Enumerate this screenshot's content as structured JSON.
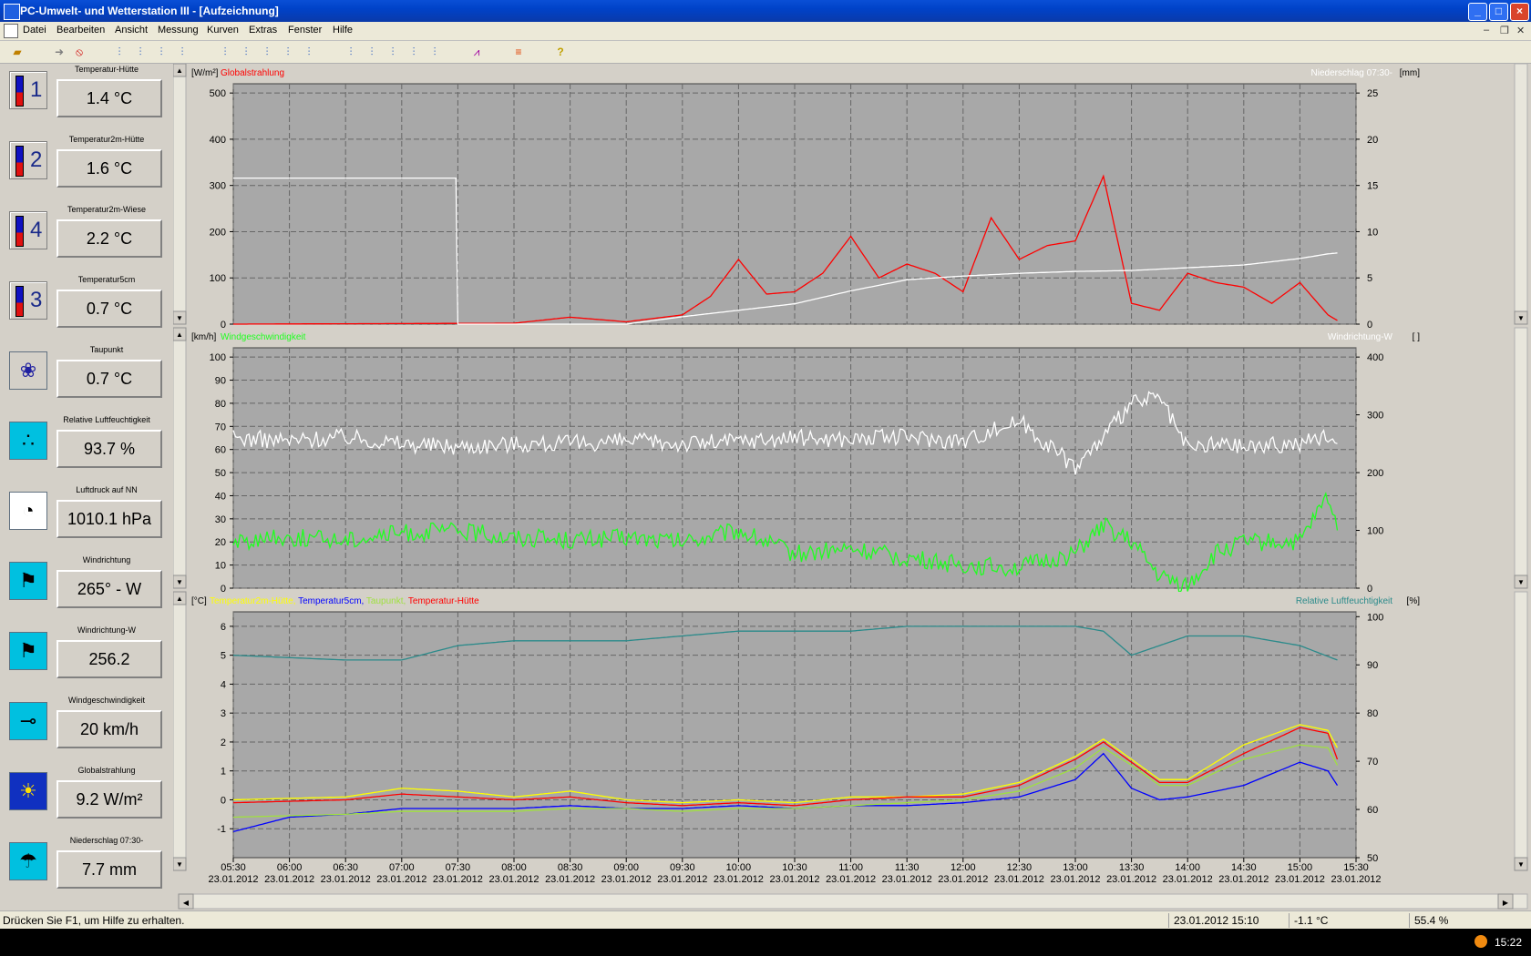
{
  "window": {
    "title": "PC-Umwelt- und Wetterstation III - [Aufzeichnung]"
  },
  "menu": [
    "Datei",
    "Bearbeiten",
    "Ansicht",
    "Messung",
    "Kurven",
    "Extras",
    "Fenster",
    "Hilfe"
  ],
  "sensors": [
    {
      "icon": "thermometer-1-icon",
      "digit": "1",
      "label": "Temperatur-Hütte",
      "value": "1.4 °C"
    },
    {
      "icon": "thermometer-2-icon",
      "digit": "2",
      "label": "Temperatur2m-Hütte",
      "value": "1.6 °C"
    },
    {
      "icon": "thermometer-4-icon",
      "digit": "4",
      "label": "Temperatur2m-Wiese",
      "value": "2.2 °C"
    },
    {
      "icon": "thermometer-3-icon",
      "digit": "3",
      "label": "Temperatur5cm",
      "value": "0.7 °C"
    },
    {
      "icon": "dewpoint-icon",
      "label": "Taupunkt",
      "value": "0.7 °C"
    },
    {
      "icon": "humidity-icon",
      "label": "Relative Luftfeuchtigkeit",
      "value": "93.7 %"
    },
    {
      "icon": "barometer-icon",
      "label": "Luftdruck auf NN",
      "value": "1010.1 hPa"
    },
    {
      "icon": "wind-direction-icon",
      "label": "Windrichtung",
      "value": "265° - W"
    },
    {
      "icon": "wind-direction-w-icon",
      "label": "Windrichtung-W",
      "value": "256.2"
    },
    {
      "icon": "wind-speed-icon",
      "label": "Windgeschwindigkeit",
      "value": "20 km/h"
    },
    {
      "icon": "global-radiation-icon",
      "label": "Globalstrahlung",
      "value": "9.2 W/m²"
    },
    {
      "icon": "precipitation-icon",
      "label": "Niederschlag 07:30-",
      "value": "7.7 mm"
    }
  ],
  "x_axis": {
    "times": [
      "05:30",
      "06:00",
      "06:30",
      "07:00",
      "07:30",
      "08:00",
      "08:30",
      "09:00",
      "09:30",
      "10:00",
      "10:30",
      "11:00",
      "11:30",
      "12:00",
      "12:30",
      "13:00",
      "13:30",
      "14:00",
      "14:30",
      "15:00",
      "15:30"
    ],
    "date": "23.01.2012"
  },
  "chart_data": [
    {
      "type": "line",
      "left_unit": "[W/m²]",
      "right_unit": "[mm]",
      "y_ticks": [
        0,
        100,
        200,
        300,
        400,
        500
      ],
      "y2_ticks": [
        0,
        5,
        10,
        15,
        20,
        25
      ],
      "ylim": [
        0,
        520
      ],
      "y2lim": [
        0,
        26
      ],
      "series": [
        {
          "name": "Globalstrahlung",
          "axis": "left",
          "color": "#ff0000",
          "x": [
            "05:30",
            "08:00",
            "08:30",
            "09:00",
            "09:30",
            "09:45",
            "10:00",
            "10:15",
            "10:30",
            "10:45",
            "11:00",
            "11:15",
            "11:30",
            "11:45",
            "12:00",
            "12:15",
            "12:30",
            "12:45",
            "13:00",
            "13:15",
            "13:30",
            "13:45",
            "14:00",
            "14:15",
            "14:30",
            "14:45",
            "15:00",
            "15:15",
            "15:20"
          ],
          "y": [
            0,
            2,
            15,
            5,
            20,
            60,
            140,
            65,
            70,
            110,
            190,
            100,
            130,
            110,
            70,
            230,
            140,
            170,
            180,
            320,
            45,
            30,
            110,
            90,
            80,
            45,
            90,
            20,
            8
          ]
        },
        {
          "name": "Niederschlag 07:30-",
          "axis": "right",
          "color": "#ffffff",
          "x": [
            "05:30",
            "07:29",
            "07:30",
            "09:00",
            "09:30",
            "10:00",
            "10:30",
            "11:00",
            "11:30",
            "12:00",
            "12:30",
            "13:00",
            "13:30",
            "14:00",
            "14:30",
            "15:00",
            "15:15",
            "15:20"
          ],
          "y": [
            15.8,
            15.8,
            0,
            0,
            0.8,
            1.5,
            2.2,
            3.6,
            4.8,
            5.2,
            5.5,
            5.7,
            5.8,
            6.1,
            6.4,
            7.1,
            7.6,
            7.7
          ]
        }
      ]
    },
    {
      "type": "line",
      "left_unit": "[km/h]",
      "right_unit": "[ ]",
      "y_ticks": [
        0,
        10,
        20,
        30,
        40,
        50,
        60,
        70,
        80,
        90,
        100
      ],
      "y2_ticks": [
        0,
        100,
        200,
        300,
        400
      ],
      "ylim": [
        0,
        104
      ],
      "y2lim": [
        0,
        416
      ],
      "series": [
        {
          "name": "Windgeschwindigkeit",
          "axis": "left",
          "color": "#20ff20",
          "x": [
            "05:30",
            "06:00",
            "06:30",
            "07:00",
            "07:30",
            "08:00",
            "08:30",
            "09:00",
            "09:30",
            "10:00",
            "10:30",
            "11:00",
            "11:30",
            "12:00",
            "12:30",
            "13:00",
            "13:15",
            "13:30",
            "13:45",
            "14:00",
            "14:15",
            "14:30",
            "15:00",
            "15:15",
            "15:20"
          ],
          "y": [
            20,
            22,
            21,
            24,
            25,
            22,
            21,
            22,
            20,
            25,
            15,
            17,
            13,
            10,
            9,
            15,
            27,
            20,
            5,
            1,
            15,
            20,
            20,
            40,
            25
          ]
        },
        {
          "name": "Windrichtung-W",
          "axis": "right",
          "color": "#ffffff",
          "x": [
            "05:30",
            "06:00",
            "06:30",
            "07:00",
            "07:30",
            "08:00",
            "08:30",
            "09:00",
            "09:30",
            "10:00",
            "10:30",
            "11:00",
            "11:30",
            "12:00",
            "12:30",
            "13:00",
            "13:15",
            "13:30",
            "13:45",
            "14:00",
            "14:15",
            "14:30",
            "15:00",
            "15:15",
            "15:20"
          ],
          "y": [
            260,
            255,
            262,
            250,
            245,
            250,
            250,
            255,
            250,
            255,
            260,
            258,
            262,
            255,
            290,
            210,
            260,
            320,
            330,
            240,
            250,
            245,
            250,
            265,
            250
          ]
        }
      ]
    },
    {
      "type": "line",
      "left_unit": "[°C]",
      "right_unit": "[%]",
      "y_ticks": [
        -1,
        0,
        1,
        2,
        3,
        4,
        5,
        6
      ],
      "y2_ticks": [
        50,
        60,
        70,
        80,
        90,
        100
      ],
      "ylim": [
        -2,
        6.5
      ],
      "y2lim": [
        50,
        101
      ],
      "series": [
        {
          "name": "Temperatur2m-Hütte",
          "axis": "left",
          "color": "#ffff00",
          "x": [
            "05:30",
            "06:30",
            "07:00",
            "07:30",
            "08:00",
            "08:30",
            "09:00",
            "09:30",
            "10:00",
            "10:30",
            "11:00",
            "11:30",
            "12:00",
            "12:30",
            "13:00",
            "13:15",
            "13:30",
            "13:45",
            "14:00",
            "14:30",
            "15:00",
            "15:15",
            "15:20"
          ],
          "y": [
            0,
            0.1,
            0.4,
            0.3,
            0.1,
            0.3,
            0,
            -0.1,
            0,
            -0.1,
            0.1,
            0.1,
            0.2,
            0.6,
            1.5,
            2.1,
            1.4,
            0.7,
            0.7,
            1.9,
            2.6,
            2.4,
            1.8
          ]
        },
        {
          "name": "Temperatur5cm",
          "axis": "left",
          "color": "#0000ff",
          "x": [
            "05:30",
            "06:00",
            "06:30",
            "07:00",
            "07:30",
            "08:00",
            "08:30",
            "09:00",
            "09:30",
            "10:00",
            "10:30",
            "11:00",
            "11:30",
            "12:00",
            "12:30",
            "13:00",
            "13:15",
            "13:30",
            "13:45",
            "14:00",
            "14:30",
            "15:00",
            "15:15",
            "15:20"
          ],
          "y": [
            -1.1,
            -0.6,
            -0.5,
            -0.3,
            -0.3,
            -0.3,
            -0.2,
            -0.3,
            -0.3,
            -0.2,
            -0.3,
            -0.2,
            -0.2,
            -0.1,
            0.1,
            0.7,
            1.6,
            0.4,
            0,
            0.1,
            0.5,
            1.3,
            1.0,
            0.5
          ]
        },
        {
          "name": "Taupunkt",
          "axis": "left",
          "color": "#a0e040",
          "x": [
            "05:30",
            "06:30",
            "07:00",
            "07:30",
            "08:00",
            "08:30",
            "09:00",
            "09:30",
            "10:00",
            "10:30",
            "11:00",
            "11:30",
            "12:00",
            "12:30",
            "13:00",
            "13:15",
            "13:30",
            "13:45",
            "14:00",
            "14:30",
            "15:00",
            "15:15",
            "15:20"
          ],
          "y": [
            -0.6,
            -0.5,
            -0.4,
            -0.4,
            -0.4,
            -0.3,
            -0.3,
            -0.4,
            -0.3,
            -0.3,
            -0.2,
            -0.1,
            0,
            0.3,
            1.1,
            1.8,
            1.2,
            0.5,
            0.5,
            1.4,
            1.9,
            1.8,
            1.2
          ]
        },
        {
          "name": "Temperatur-Hütte",
          "axis": "left",
          "color": "#ff0000",
          "x": [
            "05:30",
            "06:30",
            "07:00",
            "07:30",
            "08:00",
            "08:30",
            "09:00",
            "09:30",
            "10:00",
            "10:30",
            "11:00",
            "11:30",
            "12:00",
            "12:30",
            "13:00",
            "13:15",
            "13:30",
            "13:45",
            "14:00",
            "14:30",
            "15:00",
            "15:15",
            "15:20"
          ],
          "y": [
            -0.1,
            0,
            0.2,
            0.1,
            0,
            0.1,
            -0.1,
            -0.2,
            -0.1,
            -0.2,
            0,
            0.1,
            0.1,
            0.5,
            1.4,
            2.0,
            1.3,
            0.6,
            0.6,
            1.6,
            2.5,
            2.3,
            1.4
          ]
        },
        {
          "name": "Relative Luftfeuchtigkeit",
          "axis": "right",
          "color": "#2a8a8a",
          "x": [
            "05:30",
            "06:30",
            "07:00",
            "07:30",
            "08:00",
            "09:00",
            "09:30",
            "10:00",
            "11:00",
            "11:30",
            "12:00",
            "12:30",
            "13:00",
            "13:15",
            "13:30",
            "14:00",
            "14:30",
            "15:00",
            "15:20"
          ],
          "y": [
            92,
            91,
            91,
            94,
            95,
            95,
            96,
            97,
            97,
            98,
            98,
            98,
            98,
            97,
            92,
            96,
            96,
            94,
            91
          ]
        }
      ]
    }
  ],
  "legend_labels": {
    "c1_left": "Globalstrahlung",
    "c1_right": "Niederschlag 07:30-",
    "c2_left": "Windgeschwindigkeit",
    "c2_right": "Windrichtung-W",
    "c3_left": [
      "Temperatur2m-Hütte",
      "Temperatur5cm",
      "Taupunkt",
      "Temperatur-Hütte"
    ],
    "c3_right": "Relative Luftfeuchtigkeit"
  },
  "status": {
    "help": "Drücken Sie F1, um Hilfe zu erhalten.",
    "datetime": "23.01.2012  15:10",
    "temp": "-1.1 °C",
    "percent": "55.4 %"
  },
  "taskbar": {
    "clock": "15:22"
  },
  "colors": {
    "plot_bg": "#a8a8a8",
    "grid": "#666666",
    "radiation": "#ff0000",
    "wind": "#20ff20",
    "white": "#ffffff",
    "temp_2m": "#ffff00",
    "temp_5cm": "#0000ff",
    "dewpoint": "#a0e040",
    "humidity": "#2a8a8a"
  }
}
